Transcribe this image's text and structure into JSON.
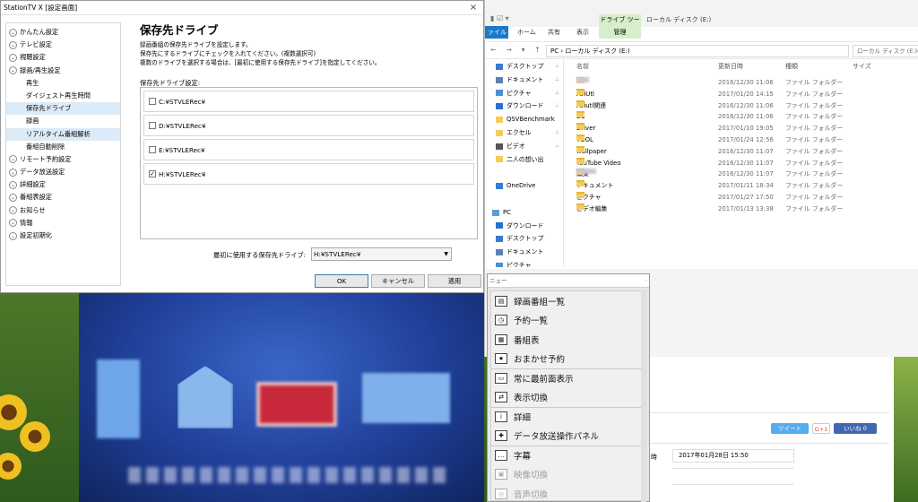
{
  "settings": {
    "title": "StationTV X [設定画面]",
    "close_glyph": "×",
    "tree": [
      {
        "label": "かんたん設定",
        "type": "parent"
      },
      {
        "label": "テレビ設定",
        "type": "parent"
      },
      {
        "label": "視聴設定",
        "type": "parent"
      },
      {
        "label": "録画/再生設定",
        "type": "parent"
      },
      {
        "label": "再生",
        "type": "child"
      },
      {
        "label": "ダイジェスト再生時間",
        "type": "child"
      },
      {
        "label": "保存先ドライブ",
        "type": "child",
        "selected": true
      },
      {
        "label": "録画",
        "type": "child"
      },
      {
        "label": "リアルタイム番組解析",
        "type": "child",
        "selected": true
      },
      {
        "label": "番組自動削除",
        "type": "child"
      },
      {
        "label": "リモート予約設定",
        "type": "parent"
      },
      {
        "label": "データ放送設定",
        "type": "parent"
      },
      {
        "label": "詳細設定",
        "type": "parent"
      },
      {
        "label": "番組表設定",
        "type": "parent"
      },
      {
        "label": "お知らせ",
        "type": "parent"
      },
      {
        "label": "情報",
        "type": "parent"
      },
      {
        "label": "設定初期化",
        "type": "parent"
      }
    ],
    "panel_title": "保存先ドライブ",
    "panel_desc": [
      "録画番組の保存先ドライブを設定します。",
      "保存先にするドライブにチェックを入れてください。(複数選択可)",
      "複数のドライブを選択する場合は、[最初に使用する保存先ドライブ]を指定してください。"
    ],
    "drive_label": "保存先ドライブ設定:",
    "drives": [
      {
        "path": "C:¥STVLERec¥",
        "checked": false
      },
      {
        "path": "D:¥STVLERec¥",
        "checked": false
      },
      {
        "path": "E:¥STVLERec¥",
        "checked": false
      },
      {
        "path": "H:¥STVLERec¥",
        "checked": true
      }
    ],
    "first_drive_label": "最初に使用する保存先ドライブ:",
    "first_drive_value": "H:¥STVLERec¥",
    "ok": "OK",
    "cancel": "キャンセル",
    "apply": "適用"
  },
  "explorer": {
    "window_title": "ローカル ディスク (E:)",
    "tabs": {
      "file": "ァイル",
      "home": "ホーム",
      "share": "共有",
      "view": "表示",
      "drive_tools": "ドライブ ツール",
      "manage": "管理"
    },
    "address": "PC  ›  ローカル ディスク (E:)",
    "search_placeholder": "ローカル ディスク (E:)の検",
    "nav": [
      {
        "label": "デスクトップ",
        "pinned": true
      },
      {
        "label": "ドキュメント",
        "pinned": true
      },
      {
        "label": "ピクチャ",
        "pinned": true
      },
      {
        "label": "ダウンロード",
        "pinned": true
      },
      {
        "label": "QSVBenchmark",
        "pinned": false
      },
      {
        "label": "エクセル",
        "pinned": true
      },
      {
        "label": "ビデオ",
        "pinned": true
      },
      {
        "label": "二人の想い出",
        "pinned": false
      },
      {
        "label": "",
        "pinned": false
      },
      {
        "label": "OneDrive",
        "pinned": false
      },
      {
        "label": "",
        "pinned": false
      },
      {
        "label": "PC",
        "pinned": false
      },
      {
        "label": "ダウンロード",
        "pinned": false
      },
      {
        "label": "デスクトップ",
        "pinned": false
      },
      {
        "label": "ドキュメント",
        "pinned": false
      },
      {
        "label": "ピクチャ",
        "pinned": false
      },
      {
        "label": "ビデオ",
        "pinned": false
      }
    ],
    "columns": {
      "name": "名前",
      "modified": "更新日時",
      "type": "種類",
      "size": "サイズ"
    },
    "files": [
      {
        "name": "",
        "blur": 14,
        "date": "2016/12/30 11:06",
        "type": "ファイル フォルダー"
      },
      {
        "name": "AviUtl",
        "blur": 0,
        "date": "2017/01/20 14:15",
        "type": "ファイル フォルダー"
      },
      {
        "name": "Aviutl関連",
        "blur": 0,
        "date": "2016/12/30 11:06",
        "type": "ファイル フォルダー"
      },
      {
        "name": "DL",
        "blur": 0,
        "date": "2016/12/30 11:06",
        "type": "ファイル フォルダー"
      },
      {
        "name": "Driver",
        "blur": 0,
        "date": "2017/01/10 19:05",
        "type": "ファイル フォルダー"
      },
      {
        "name": "TOOL",
        "blur": 0,
        "date": "2017/01/24 12:56",
        "type": "ファイル フォルダー"
      },
      {
        "name": "wallpaper",
        "blur": 0,
        "date": "2016/12/30 11:07",
        "type": "ファイル フォルダー"
      },
      {
        "name": "YouTube Video",
        "blur": 0,
        "date": "2016/12/30 11:07",
        "type": "ファイル フォルダー"
      },
      {
        "name": "編集",
        "blur": 22,
        "date": "2016/12/30 11:07",
        "type": "ファイル フォルダー"
      },
      {
        "name": "ドキュメント",
        "blur": 0,
        "date": "2017/01/11 18:34",
        "type": "ファイル フォルダー"
      },
      {
        "name": "ピクチャ",
        "blur": 0,
        "date": "2017/01/27 17:50",
        "type": "ファイル フォルダー"
      },
      {
        "name": "ビデオ編集",
        "blur": 0,
        "date": "2017/01/13 13:38",
        "type": "ファイル フォルダー"
      }
    ]
  },
  "web": {
    "tweet": "ツイート",
    "gplus": "G+1",
    "like": "いいね 0",
    "date_label": "時",
    "date_value": "2017年01月28日 15:50"
  },
  "menu": {
    "header": "ニュー",
    "items": [
      {
        "label": "録画番組一覧",
        "icon": "▤",
        "disabled": false,
        "sep": false
      },
      {
        "label": "予約一覧",
        "icon": "◷",
        "disabled": false,
        "sep": false
      },
      {
        "label": "番組表",
        "icon": "▦",
        "disabled": false,
        "sep": false
      },
      {
        "label": "おまかせ予約",
        "icon": "★",
        "disabled": false,
        "sep": false
      },
      {
        "label": "常に最前面表示",
        "icon": "▭",
        "disabled": false,
        "sep": true
      },
      {
        "label": "表示切換",
        "icon": "⇄",
        "disabled": false,
        "sep": false
      },
      {
        "label": "詳細",
        "icon": "i",
        "disabled": false,
        "sep": true
      },
      {
        "label": "データ放送操作パネル",
        "icon": "✚",
        "disabled": false,
        "sep": false
      },
      {
        "label": "字幕",
        "icon": "…",
        "disabled": false,
        "sep": true
      },
      {
        "label": "映像切換",
        "icon": "▣",
        "disabled": true,
        "sep": false
      },
      {
        "label": "音声切換",
        "icon": "◎",
        "disabled": true,
        "sep": false
      }
    ]
  },
  "colors": {
    "accent": "#1979ca",
    "selection": "#dcebf8",
    "drive_tools": "#d7eecb"
  }
}
